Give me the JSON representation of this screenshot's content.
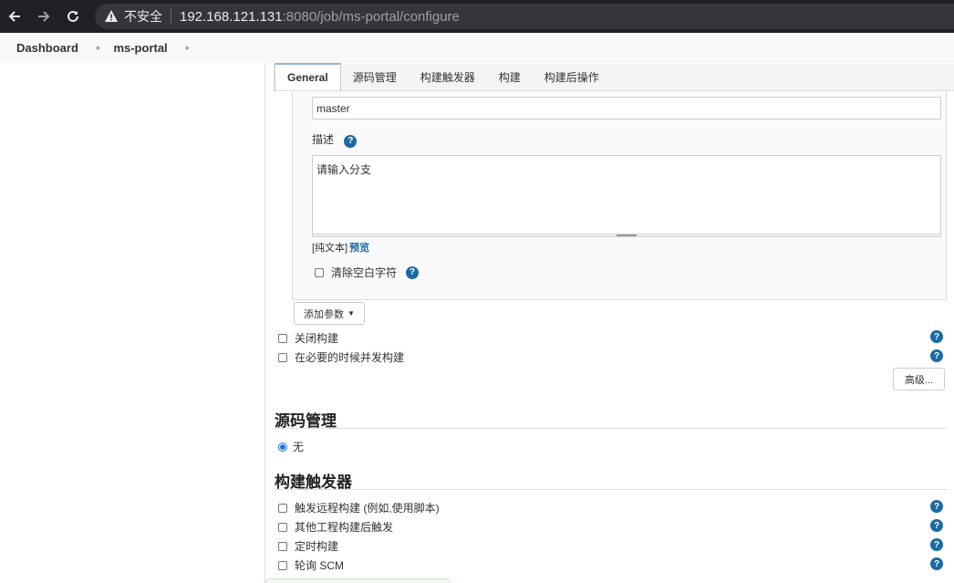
{
  "browser": {
    "insecure_label": "不安全",
    "url_host": "192.168.121.131",
    "url_rest": ":8080/job/ms-portal/configure"
  },
  "breadcrumb": {
    "items": [
      "Dashboard",
      "ms-portal"
    ]
  },
  "tabs": [
    "General",
    "源码管理",
    "构建触发器",
    "构建",
    "构建后操作"
  ],
  "param": {
    "default_value": "master",
    "desc_label": "描述",
    "desc_value": "请输入分支",
    "plain_text": "[纯文本]",
    "preview": "预览",
    "trim_label": "清除空白字符"
  },
  "add_param_label": "添加参数",
  "general_options": [
    "关闭构建",
    "在必要的时候并发构建"
  ],
  "advanced_label": "高级...",
  "scm": {
    "title": "源码管理",
    "option": "无"
  },
  "triggers": {
    "title": "构建触发器",
    "options": [
      "触发远程构建 (例如,使用脚本)",
      "其他工程构建后触发",
      "定时构建",
      "轮询 SCM"
    ]
  },
  "help_glyph": "?",
  "colors": {
    "accent": "#1b6aa5",
    "radio": "#1a73e8"
  }
}
